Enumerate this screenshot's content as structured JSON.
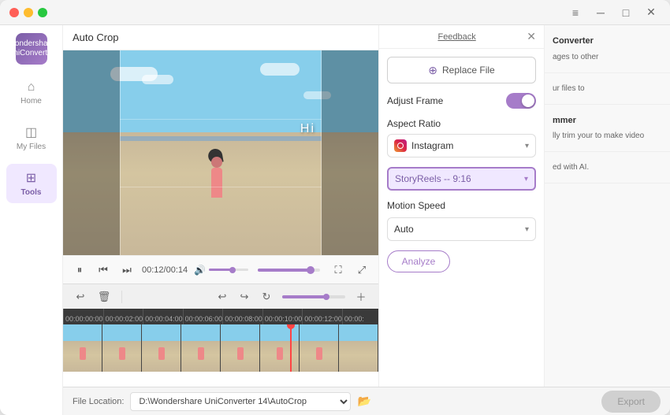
{
  "window": {
    "title": "Wondershare UniConverter",
    "subtitle": "UniCon..."
  },
  "titlebar": {
    "menu_icon": "≡",
    "minimize": "─",
    "maximize": "□",
    "close": "✕"
  },
  "sidebar": {
    "logo_text": "W",
    "items": [
      {
        "id": "home",
        "label": "Home",
        "icon": "⌂",
        "active": false
      },
      {
        "id": "my-files",
        "label": "My Files",
        "icon": "📁",
        "active": false
      },
      {
        "id": "tools",
        "label": "Tools",
        "icon": "🧰",
        "active": true
      }
    ]
  },
  "autocrop": {
    "header": "Auto Crop",
    "feedback_label": "Feedback",
    "close_icon": "✕"
  },
  "video": {
    "text_overlay": "Hi",
    "time_current": "00:12",
    "time_total": "00:14"
  },
  "timeline": {
    "ruler_marks": [
      "00:00:00:00",
      "00:00:02:00",
      "00:00:04:00",
      "00:00:06:00",
      "00:00:08:00",
      "00:00:10:00",
      "00:00:12:00",
      "00:00:"
    ]
  },
  "panel": {
    "replace_btn": "Replace File",
    "adjust_frame_label": "Adjust Frame",
    "aspect_ratio_label": "Aspect Ratio",
    "aspect_ratio_value": "Instagram",
    "sub_ratio_value": "StoryReels -- 9:16",
    "motion_speed_label": "Motion Speed",
    "motion_speed_value": "Auto",
    "analyze_btn": "Analyze"
  },
  "promo": {
    "items": [
      {
        "title": "Converter",
        "desc": "ages to other"
      },
      {
        "title": "",
        "desc": "ur files to"
      },
      {
        "title": "mmer",
        "desc": "lly trim your\nto make video\n"
      },
      {
        "title": "",
        "desc": "ed with AI."
      }
    ]
  },
  "bottom": {
    "file_location_label": "File Location:",
    "file_path": "D:\\Wondershare UniConverter 14\\AutoCrop",
    "export_btn": "Export"
  },
  "icons": {
    "pause": "⏸",
    "skip_back": "⏮",
    "skip_forward": "⏭",
    "volume": "🔊",
    "fullscreen": "⛶",
    "expand": "⤢",
    "undo": "↩",
    "redo": "↪",
    "redo2": "↻",
    "add": "＋",
    "delete": "🗑",
    "undo_toolbar": "↩",
    "folder": "📂",
    "plus_replace": "⊕"
  }
}
